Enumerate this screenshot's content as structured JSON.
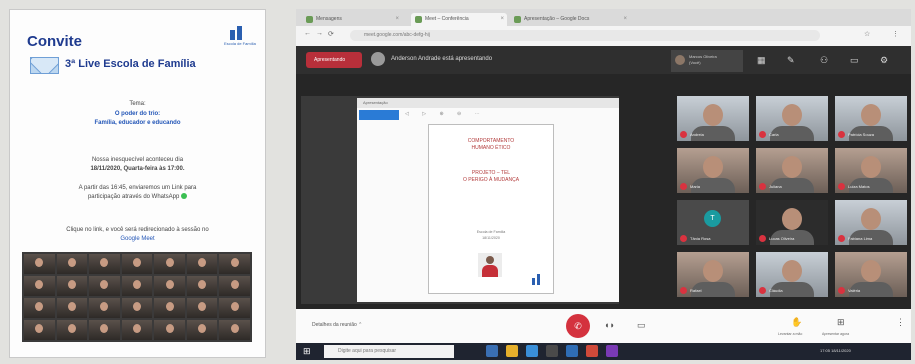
{
  "invite": {
    "title": "Convite",
    "subtitle": "3ª Live Escola de Família",
    "theme_label": "Tema:",
    "theme_line1": "O poder do trio:",
    "theme_line2": "Família, educador e educando",
    "meeting_line1": "Nossa inesquecível aconteceu dia",
    "meeting_line2": "18/11/2020, Quarta-feira às 17:00.",
    "invite_line1": "A partir das 16:45, enviaremos um Link para",
    "invite_line2": "participação através do WhatsApp",
    "click_line1": "Clique no link, e você será redirecionado à sessão no",
    "click_line2": "Google Meet",
    "logo_caption": "Escola de Família"
  },
  "browser": {
    "tabs": [
      {
        "label": "Mensagens"
      },
      {
        "label": "Meet – Conferência"
      },
      {
        "label": "Apresentação – Google Docs"
      }
    ],
    "url": "meet.google.com/abc-defg-hij"
  },
  "meet": {
    "present_button": "Apresentando",
    "presenter_text": "Anderson Andrade está apresentando",
    "self_name": "Marcos Oliveira",
    "self_sub": "(Você)",
    "slide_window_title": "Apresentação",
    "slide_title_line1": "COMPORTAMENTO",
    "slide_title_line2": "HUMANO ÉTICO",
    "slide_title_line3": "PROJETO – TEL",
    "slide_title_line4": "O PERIGO À MUDANÇA",
    "slide_caption_line1": "Escola de Família",
    "slide_caption_line2": "18/11/2020",
    "details_label": "Detalhes da reunião",
    "end_call_icon": "phone-hangup-icon",
    "raise_hand_label": "Levantar a mão",
    "present_now_label": "Apresentar agora",
    "participants": [
      {
        "name": "Andreia",
        "style": "light"
      },
      {
        "name": "Carla",
        "style": "light"
      },
      {
        "name": "Patrícia Souza",
        "style": "light"
      },
      {
        "name": "Maria",
        "style": "warm"
      },
      {
        "name": "Juliana",
        "style": "warm"
      },
      {
        "name": "Luiza Matos",
        "style": "warm"
      },
      {
        "name": "Tânia Rosa",
        "style": "initial",
        "initial": "T"
      },
      {
        "name": "Lucas Oliveira",
        "style": "dark"
      },
      {
        "name": "Fabiana Lima",
        "style": "light"
      },
      {
        "name": "Rafael",
        "style": "warm"
      },
      {
        "name": "Cláudia",
        "style": "light"
      },
      {
        "name": "Valéria",
        "style": "warm"
      }
    ]
  },
  "taskbar": {
    "search_placeholder": "Digite aqui para pesquisar",
    "tray_text": "17:05  18/11/2020"
  },
  "colors": {
    "accent_red": "#d4323e",
    "invite_blue": "#1f3b8f",
    "whatsapp_green": "#2b9b3c"
  }
}
